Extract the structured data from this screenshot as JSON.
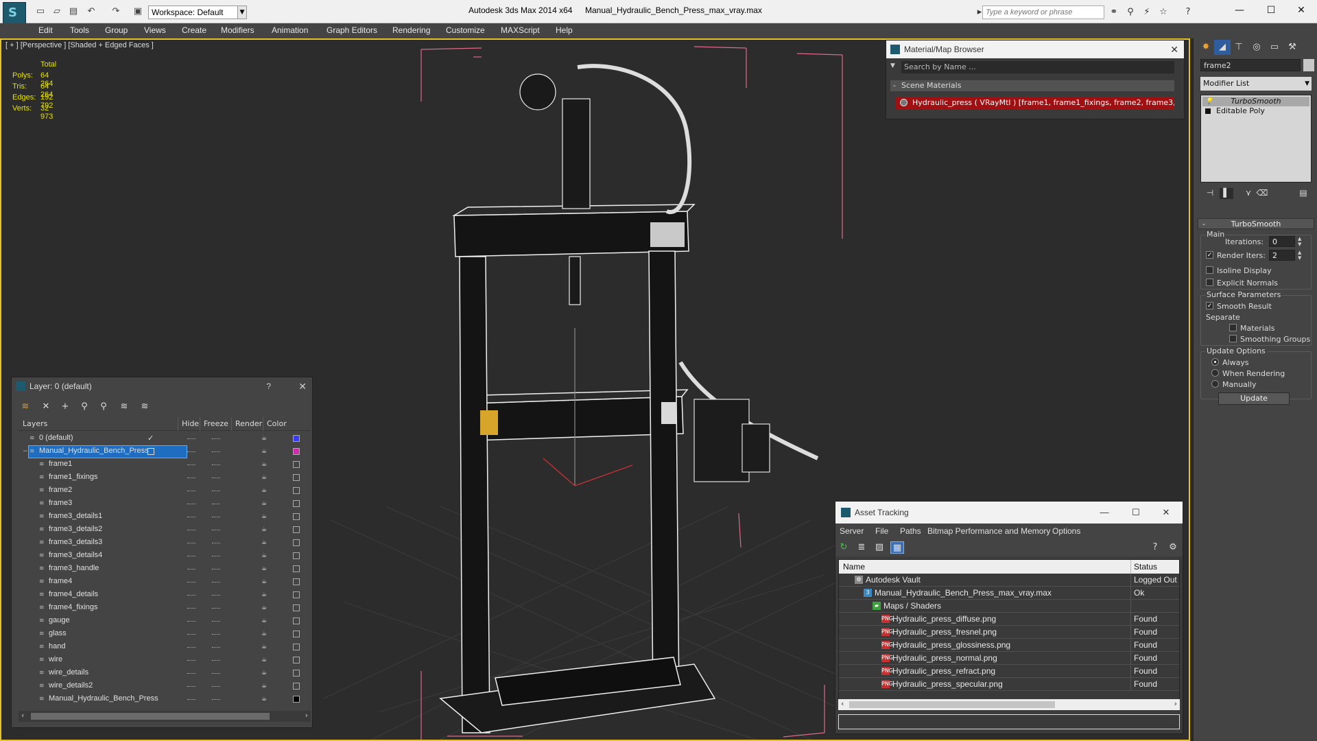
{
  "titlebar": {
    "workspace": "Workspace: Default",
    "app_title": "Autodesk 3ds Max  2014 x64",
    "file_title": "Manual_Hydraulic_Bench_Press_max_vray.max",
    "search_placeholder": "Type a keyword or phrase"
  },
  "menu": [
    "Edit",
    "Tools",
    "Group",
    "Views",
    "Create",
    "Modifiers",
    "Animation",
    "Graph Editors",
    "Rendering",
    "Customize",
    "MAXScript",
    "Help"
  ],
  "viewport": {
    "label": "[ + ] [Perspective ] [Shaded + Edged Faces ]",
    "stats": {
      "header": "Total",
      "polys_label": "Polys:",
      "polys": "64 264",
      "tris_label": "Tris:",
      "tris": "64 264",
      "edges_label": "Edges:",
      "edges": "192 792",
      "verts_label": "Verts:",
      "verts": "32 973"
    }
  },
  "material_browser": {
    "title": "Material/Map Browser",
    "search": "Search by Name ...",
    "section": "Scene Materials",
    "item": "Hydraulic_press  ( VRayMtl )  [frame1, frame1_fixings, frame2, frame3, f..."
  },
  "command_panel": {
    "object_name": "frame2",
    "modifier_list": "Modifier List",
    "stack": [
      "TurboSmooth",
      "Editable Poly"
    ],
    "rollout_title": "TurboSmooth",
    "main_label": "Main",
    "iterations_label": "Iterations:",
    "iterations": "0",
    "render_iters_label": "Render Iters:",
    "render_iters": "2",
    "isoline": "Isoline Display",
    "explicit_normals": "Explicit Normals",
    "surface_params": "Surface Parameters",
    "smooth_result": "Smooth Result",
    "separate": "Separate",
    "materials": "Materials",
    "smoothing_groups": "Smoothing Groups",
    "update_options": "Update Options",
    "always": "Always",
    "when_rendering": "When Rendering",
    "manually": "Manually",
    "update_button": "Update"
  },
  "layer_panel": {
    "title": "Layer: 0 (default)",
    "help": "?",
    "columns": {
      "layers": "Layers",
      "hide": "Hide",
      "freeze": "Freeze",
      "render": "Render",
      "color": "Color"
    },
    "rows": [
      {
        "name": "0 (default)",
        "level": 1,
        "color": "#3a3aff",
        "active": true
      },
      {
        "name": "Manual_Hydraulic_Bench_Press",
        "level": 1,
        "color": "#d02ab0",
        "selected": true
      },
      {
        "name": "frame1",
        "level": 2,
        "color": "#444444"
      },
      {
        "name": "frame1_fixings",
        "level": 2,
        "color": "#444444"
      },
      {
        "name": "frame2",
        "level": 2,
        "color": "#444444"
      },
      {
        "name": "frame3",
        "level": 2,
        "color": "#444444"
      },
      {
        "name": "frame3_details1",
        "level": 2,
        "color": "#444444"
      },
      {
        "name": "frame3_details2",
        "level": 2,
        "color": "#444444"
      },
      {
        "name": "frame3_details3",
        "level": 2,
        "color": "#444444"
      },
      {
        "name": "frame3_details4",
        "level": 2,
        "color": "#444444"
      },
      {
        "name": "frame3_handle",
        "level": 2,
        "color": "#444444"
      },
      {
        "name": "frame4",
        "level": 2,
        "color": "#444444"
      },
      {
        "name": "frame4_details",
        "level": 2,
        "color": "#444444"
      },
      {
        "name": "frame4_fixings",
        "level": 2,
        "color": "#444444"
      },
      {
        "name": "gauge",
        "level": 2,
        "color": "#444444"
      },
      {
        "name": "glass",
        "level": 2,
        "color": "#444444"
      },
      {
        "name": "hand",
        "level": 2,
        "color": "#444444"
      },
      {
        "name": "wire",
        "level": 2,
        "color": "#444444"
      },
      {
        "name": "wire_details",
        "level": 2,
        "color": "#444444"
      },
      {
        "name": "wire_details2",
        "level": 2,
        "color": "#444444"
      },
      {
        "name": "Manual_Hydraulic_Bench_Press",
        "level": 2,
        "color": "#000000"
      }
    ]
  },
  "asset_tracking": {
    "title": "Asset Tracking",
    "menu": [
      "Server",
      "File",
      "Paths",
      "Bitmap Performance and Memory",
      "Options"
    ],
    "columns": {
      "name": "Name",
      "status": "Status"
    },
    "rows": [
      {
        "name": "Autodesk Vault",
        "status": "Logged Out",
        "level": 1,
        "icon": "vault"
      },
      {
        "name": "Manual_Hydraulic_Bench_Press_max_vray.max",
        "status": "Ok",
        "level": 2,
        "icon": "max"
      },
      {
        "name": "Maps / Shaders",
        "status": "",
        "level": 3,
        "icon": "maps"
      },
      {
        "name": "Hydraulic_press_diffuse.png",
        "status": "Found",
        "level": 4,
        "icon": "png"
      },
      {
        "name": "Hydraulic_press_fresnel.png",
        "status": "Found",
        "level": 4,
        "icon": "png"
      },
      {
        "name": "Hydraulic_press_glossiness.png",
        "status": "Found",
        "level": 4,
        "icon": "png"
      },
      {
        "name": "Hydraulic_press_normal.png",
        "status": "Found",
        "level": 4,
        "icon": "png"
      },
      {
        "name": "Hydraulic_press_refract.png",
        "status": "Found",
        "level": 4,
        "icon": "png"
      },
      {
        "name": "Hydraulic_press_specular.png",
        "status": "Found",
        "level": 4,
        "icon": "png"
      }
    ]
  },
  "colors": {
    "accent": "#1e6dc0",
    "viewport_border": "#e5c12b",
    "stats": "#e6e200",
    "material_selected": "#9e1012"
  }
}
